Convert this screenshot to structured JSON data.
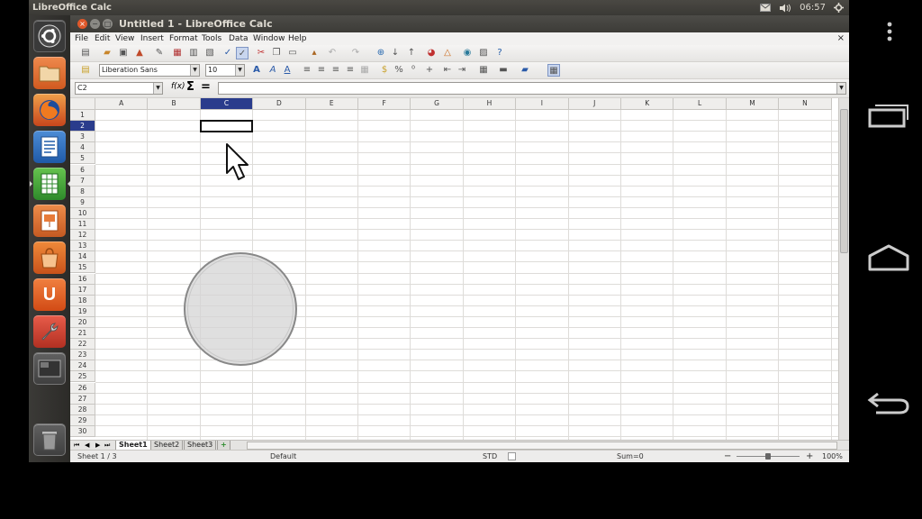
{
  "top_panel": {
    "app_title": "LibreOffice Calc",
    "clock": "06:57",
    "mail_icon": "envelope-icon",
    "sound_icon": "speaker-icon",
    "session_icon": "gear-icon"
  },
  "launcher": {
    "items": [
      {
        "name": "dash-home",
        "icon": "ubuntu-logo-icon",
        "color": "#3a3a3a"
      },
      {
        "name": "files",
        "icon": "folder-icon",
        "color": "#e0692f"
      },
      {
        "name": "firefox",
        "icon": "firefox-icon",
        "color": "#e06a1e"
      },
      {
        "name": "writer",
        "icon": "writer-icon",
        "color": "#2b6ab7"
      },
      {
        "name": "calc",
        "icon": "calc-icon",
        "color": "#3aa43a"
      },
      {
        "name": "impress",
        "icon": "impress-icon",
        "color": "#d5652d"
      },
      {
        "name": "software-center",
        "icon": "shopping-bag-icon",
        "color": "#dd6a20"
      },
      {
        "name": "ubuntu-one",
        "icon": "ubuntu-one-icon",
        "color": "#e85d21"
      },
      {
        "name": "system-settings",
        "icon": "wrench-icon",
        "color": "#d74b3a"
      },
      {
        "name": "workspaces",
        "icon": "workspace-icon",
        "color": "#555555"
      },
      {
        "name": "trash",
        "icon": "trash-icon",
        "color": "#555555"
      }
    ],
    "u_label": "U"
  },
  "window": {
    "title": "Untitled 1 - LibreOffice Calc",
    "close_glyph": "×",
    "minimize_glyph": "−",
    "maximize_glyph": "□"
  },
  "menus": [
    "File",
    "Edit",
    "View",
    "Insert",
    "Format",
    "Tools",
    "Data",
    "Window",
    "Help"
  ],
  "doc_close": "×",
  "formatting": {
    "font_name": "Liberation Sans",
    "font_size": "10"
  },
  "formula_bar": {
    "name_box": "C2",
    "function_wizard": "f(x)",
    "sum": "Σ",
    "equals": "=",
    "input_value": ""
  },
  "columns": [
    "A",
    "B",
    "C",
    "D",
    "E",
    "F",
    "G",
    "H",
    "I",
    "J",
    "K",
    "L",
    "M",
    "N"
  ],
  "rows": [
    "1",
    "2",
    "3",
    "4",
    "5",
    "6",
    "7",
    "8",
    "9",
    "10",
    "11",
    "12",
    "13",
    "14",
    "15",
    "16",
    "17",
    "18",
    "19",
    "20",
    "21",
    "22",
    "23",
    "24",
    "25",
    "26",
    "27",
    "28",
    "29",
    "30"
  ],
  "selection": {
    "column": "C",
    "row": "2"
  },
  "sheets": [
    {
      "name": "Sheet1",
      "active": true
    },
    {
      "name": "Sheet2",
      "active": false
    },
    {
      "name": "Sheet3",
      "active": false
    }
  ],
  "add_sheet_glyph": "+",
  "status": {
    "sheet_position": "Sheet 1 / 3",
    "page_style": "Default",
    "selection_mode": "STD",
    "sum": "Sum=0",
    "zoom": "100%",
    "zoom_minus": "−",
    "zoom_plus": "+"
  },
  "colors": {
    "selected_header": "#2a3c8c",
    "circle_fill": "#d4d4d4",
    "circle_stroke": "#888888"
  }
}
